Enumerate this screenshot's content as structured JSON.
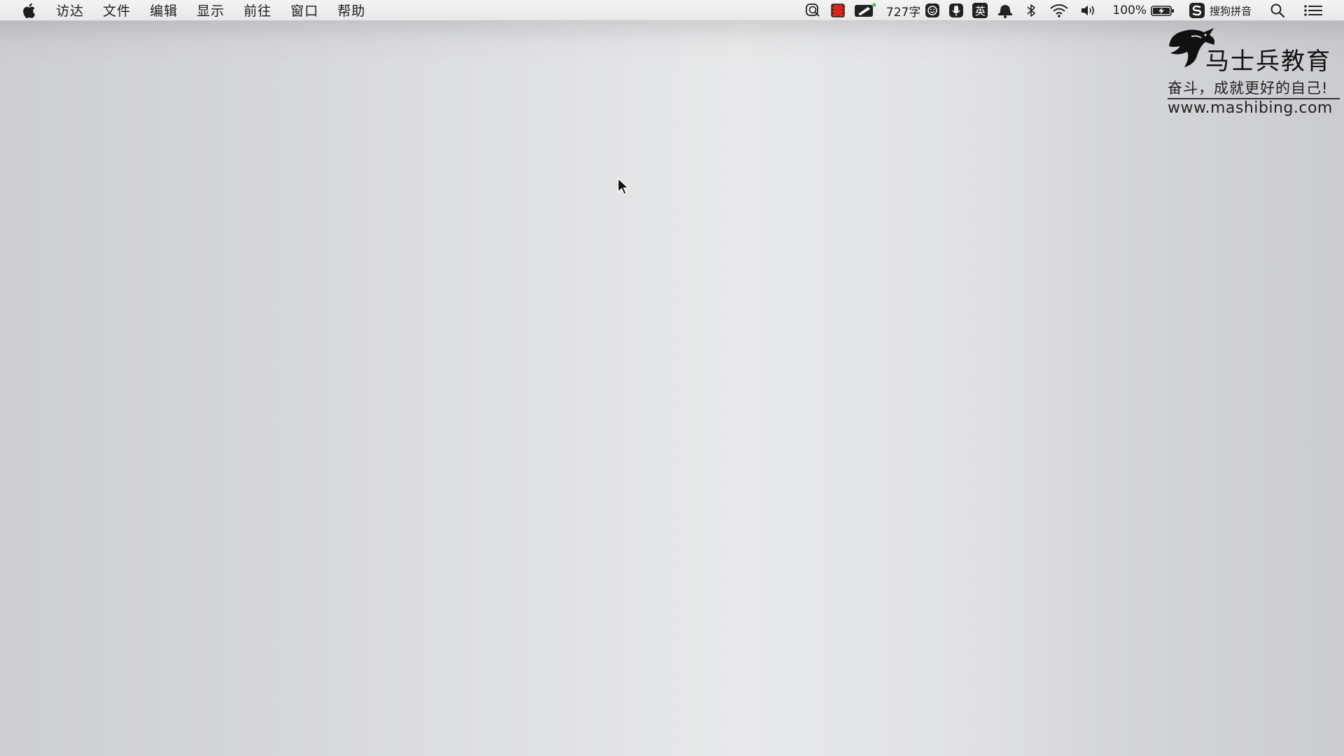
{
  "menubar": {
    "apple_icon": "apple-logo-icon",
    "items": [
      {
        "label": "访达"
      },
      {
        "label": "文件"
      },
      {
        "label": "编辑"
      },
      {
        "label": "显示"
      },
      {
        "label": "前往"
      },
      {
        "label": "窗口"
      },
      {
        "label": "帮助"
      }
    ],
    "status": {
      "word_count": "727字",
      "ime_mode": "英",
      "battery_percent": "100%",
      "ime_name": "搜狗拼音"
    }
  },
  "brand": {
    "title": "马士兵教育",
    "slogan": "奋斗，成就更好的自己!",
    "url": "www.mashibing.com"
  },
  "colors": {
    "menubar_bg": "#eeeeef",
    "desktop_center": "#e8e9ea",
    "desktop_edge": "#cbcccf",
    "recording_red": "#d9261c"
  }
}
